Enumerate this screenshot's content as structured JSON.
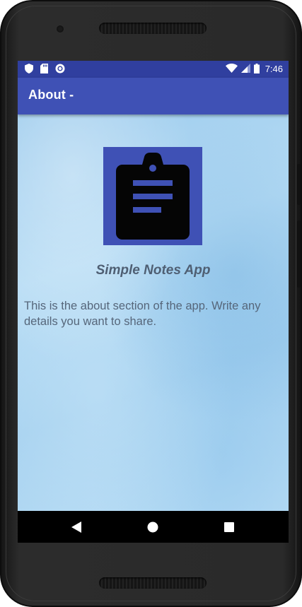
{
  "status_bar": {
    "time": "7:46",
    "left_icons": [
      "shield-icon",
      "sd-card-icon",
      "sync-circle-icon"
    ],
    "right_icons": [
      "wifi-icon",
      "cell-signal-icon",
      "battery-icon"
    ]
  },
  "app_bar": {
    "title": "About -"
  },
  "about": {
    "app_name": "Simple Notes App",
    "description": "This is the about section of the app. Write any details you want to share.",
    "logo_icon": "clipboard-notes-icon"
  },
  "nav_bar": {
    "buttons": [
      "back-icon",
      "home-icon",
      "recents-icon"
    ]
  },
  "colors": {
    "status_bar": "#303f9f",
    "app_bar": "#3f51b5",
    "logo_background": "#3f51b5",
    "text": "#56667a"
  }
}
